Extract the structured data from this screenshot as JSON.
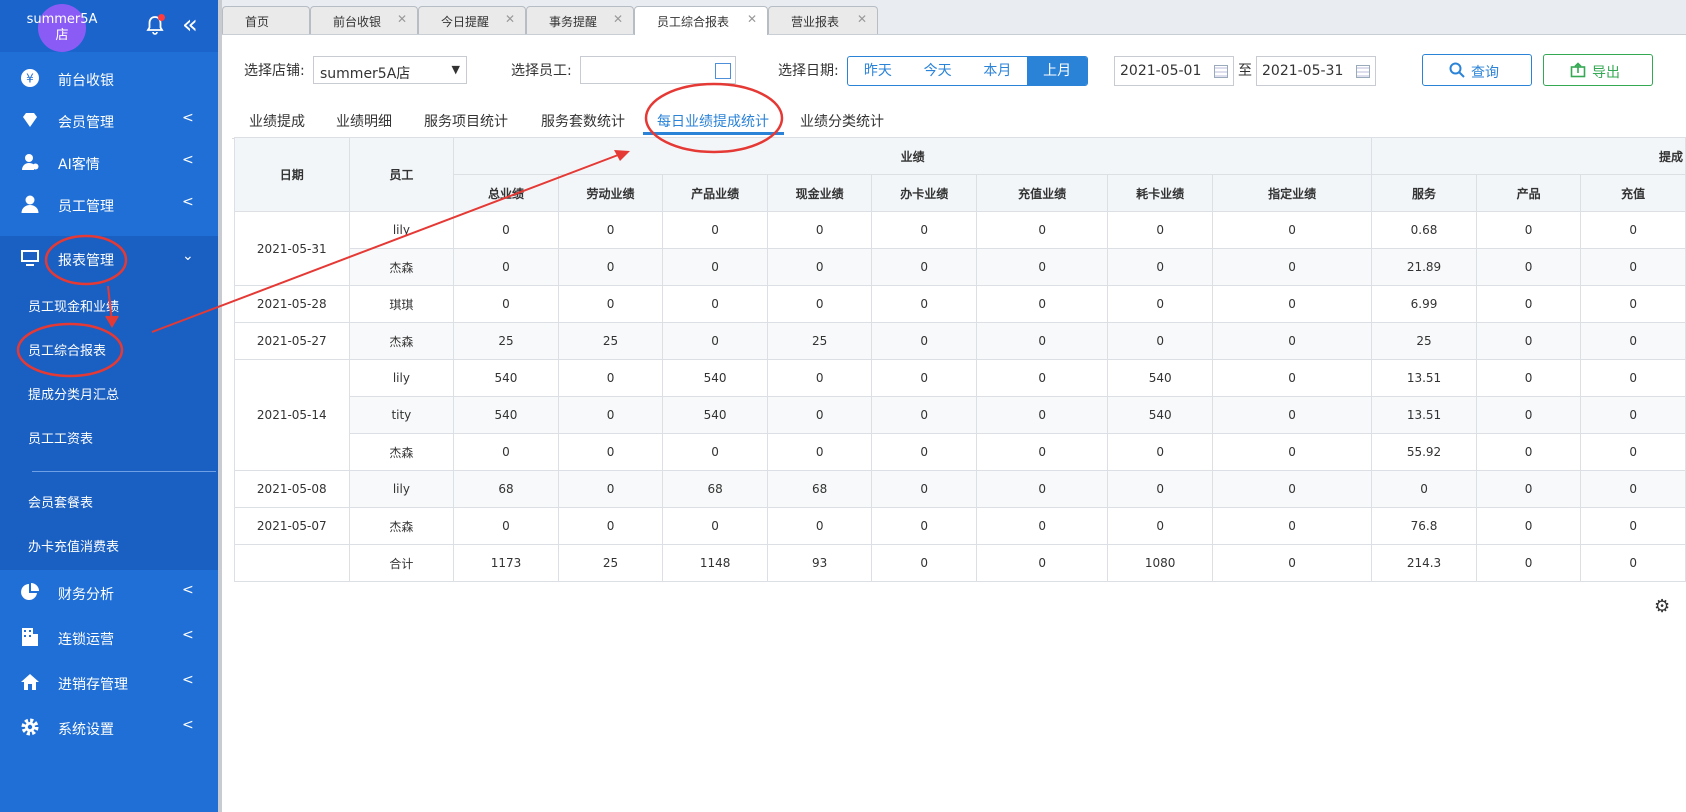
{
  "sidebar": {
    "avatar_text": "summer5A店",
    "items": [
      {
        "label": "前台收银",
        "icon": "yen-icon"
      },
      {
        "label": "会员管理",
        "icon": "diamond-icon",
        "chev": "<"
      },
      {
        "label": "AI客情",
        "icon": "user-chat-icon",
        "chev": "<"
      },
      {
        "label": "员工管理",
        "icon": "user-icon",
        "chev": "<"
      },
      {
        "label": "报表管理",
        "icon": "monitor-icon",
        "chev": "v"
      },
      {
        "label": "财务分析",
        "icon": "pie-icon",
        "chev": "<"
      },
      {
        "label": "连锁运营",
        "icon": "building-icon",
        "chev": "<"
      },
      {
        "label": "进销存管理",
        "icon": "home-icon",
        "chev": "<"
      },
      {
        "label": "系统设置",
        "icon": "gear-icon",
        "chev": "<"
      }
    ],
    "sub_items": [
      "员工现金和业绩",
      "员工综合报表",
      "提成分类月汇总",
      "员工工资表",
      "会员套餐表",
      "办卡充值消费表"
    ]
  },
  "tabs": [
    {
      "label": "首页",
      "close": ""
    },
    {
      "label": "前台收银",
      "close": "✕"
    },
    {
      "label": "今日提醒",
      "close": "✕"
    },
    {
      "label": "事务提醒",
      "close": "✕"
    },
    {
      "label": "员工综合报表",
      "close": "✕"
    },
    {
      "label": "营业报表",
      "close": "✕"
    }
  ],
  "filters": {
    "store_label": "选择店铺:",
    "store_value": "summer5A店",
    "employee_label": "选择员工:",
    "date_label": "选择日期:",
    "date_options": [
      "昨天",
      "今天",
      "本月",
      "上月"
    ],
    "date_from": "2021-05-01",
    "date_sep": "至",
    "date_to": "2021-05-31",
    "query": "查询",
    "export": "导出"
  },
  "subtabs": [
    "业绩提成",
    "业绩明细",
    "服务项目统计",
    "服务套数统计",
    "每日业绩提成统计",
    "业绩分类统计"
  ],
  "table": {
    "head_date": "日期",
    "head_emp": "员工",
    "group_perf": "业绩",
    "group_comm": "提成",
    "columns": [
      "总业绩",
      "劳动业绩",
      "产品业绩",
      "现金业绩",
      "办卡业绩",
      "充值业绩",
      "耗卡业绩",
      "指定业绩",
      "服务",
      "产品",
      "充值"
    ],
    "groups": [
      {
        "date": "2021-05-31",
        "rows": [
          {
            "emp": "lily",
            "v": [
              "0",
              "0",
              "0",
              "0",
              "0",
              "0",
              "0",
              "0",
              "0.68",
              "0",
              "0"
            ]
          },
          {
            "emp": "杰森",
            "v": [
              "0",
              "0",
              "0",
              "0",
              "0",
              "0",
              "0",
              "0",
              "21.89",
              "0",
              "0"
            ]
          }
        ]
      },
      {
        "date": "2021-05-28",
        "rows": [
          {
            "emp": "琪琪",
            "v": [
              "0",
              "0",
              "0",
              "0",
              "0",
              "0",
              "0",
              "0",
              "6.99",
              "0",
              "0"
            ]
          }
        ]
      },
      {
        "date": "2021-05-27",
        "rows": [
          {
            "emp": "杰森",
            "v": [
              "25",
              "25",
              "0",
              "25",
              "0",
              "0",
              "0",
              "0",
              "25",
              "0",
              "0"
            ]
          }
        ]
      },
      {
        "date": "2021-05-14",
        "rows": [
          {
            "emp": "lily",
            "v": [
              "540",
              "0",
              "540",
              "0",
              "0",
              "0",
              "540",
              "0",
              "13.51",
              "0",
              "0"
            ]
          },
          {
            "emp": "tity",
            "v": [
              "540",
              "0",
              "540",
              "0",
              "0",
              "0",
              "540",
              "0",
              "13.51",
              "0",
              "0"
            ]
          },
          {
            "emp": "杰森",
            "v": [
              "0",
              "0",
              "0",
              "0",
              "0",
              "0",
              "0",
              "0",
              "55.92",
              "0",
              "0"
            ]
          }
        ]
      },
      {
        "date": "2021-05-08",
        "rows": [
          {
            "emp": "lily",
            "v": [
              "68",
              "0",
              "68",
              "68",
              "0",
              "0",
              "0",
              "0",
              "0",
              "0",
              "0"
            ]
          }
        ]
      },
      {
        "date": "2021-05-07",
        "rows": [
          {
            "emp": "杰森",
            "v": [
              "0",
              "0",
              "0",
              "0",
              "0",
              "0",
              "0",
              "0",
              "76.8",
              "0",
              "0"
            ]
          }
        ]
      }
    ],
    "total": {
      "label": "合计",
      "v": [
        "1173",
        "25",
        "1148",
        "93",
        "0",
        "0",
        "1080",
        "0",
        "214.3",
        "0",
        "0"
      ]
    }
  },
  "colors": {
    "sidebar": "#1f6fd6",
    "accent": "#2b83d8",
    "export": "#34a853",
    "annotation": "#e53935"
  }
}
